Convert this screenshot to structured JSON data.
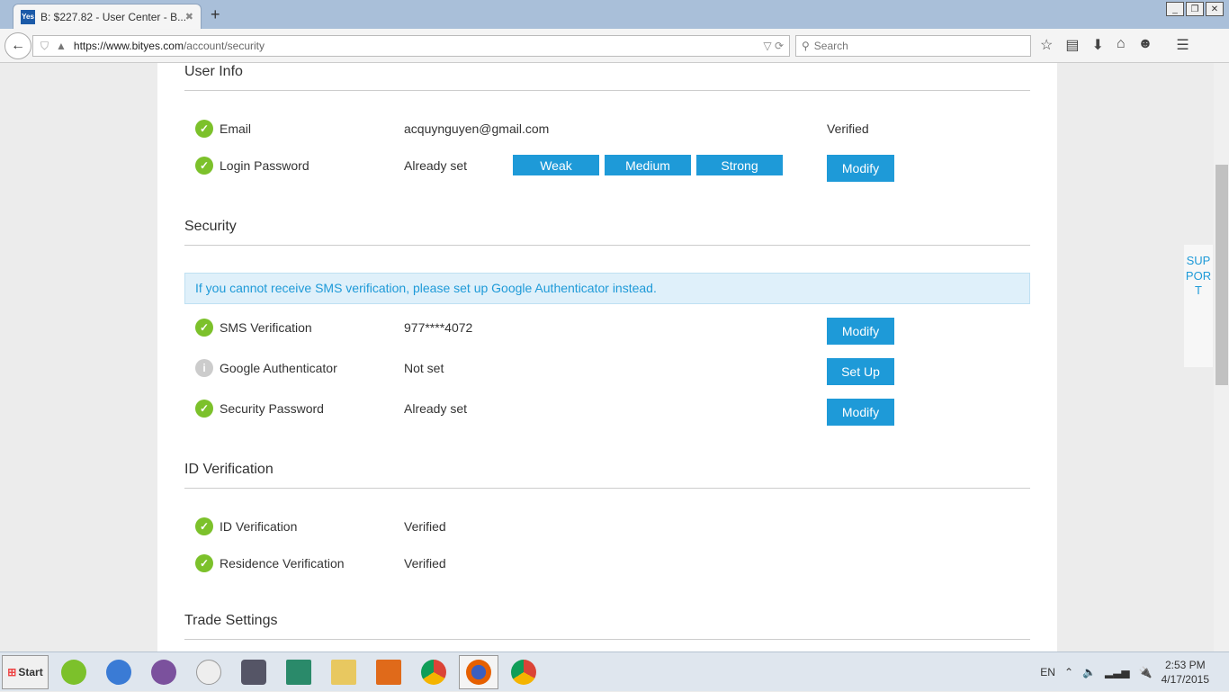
{
  "browser": {
    "tab_title": "B: $227.82 - User Center - B...",
    "favicon": "Yes",
    "url_host": "https://www.bityes.com",
    "url_path": "/account/security",
    "search_placeholder": "Search"
  },
  "user_info": {
    "title": "User Info",
    "email_label": "Email",
    "email": "acquynguyen@gmail.com",
    "email_status": "Verified",
    "password_label": "Login Password",
    "password_status": "Already set",
    "strength": [
      "Weak",
      "Medium",
      "Strong"
    ],
    "modify": "Modify"
  },
  "security": {
    "title": "Security",
    "alert": "If you cannot receive SMS verification, please set up Google Authenticator instead.",
    "sms_label": "SMS Verification",
    "sms_value": "977****4072",
    "sms_btn": "Modify",
    "ga_label": "Google Authenticator",
    "ga_value": "Not set",
    "ga_btn": "Set Up",
    "sp_label": "Security Password",
    "sp_value": "Already set",
    "sp_btn": "Modify"
  },
  "id": {
    "title": "ID Verification",
    "id_label": "ID Verification",
    "id_value": "Verified",
    "res_label": "Residence Verification",
    "res_value": "Verified"
  },
  "trade": {
    "title": "Trade Settings"
  },
  "support": "SUPPORT",
  "taskbar": {
    "start": "Start",
    "lang": "EN",
    "time": "2:53 PM",
    "date": "4/17/2015"
  },
  "colors": {
    "accent": "#1e9ad8",
    "check": "#7cc12b"
  }
}
